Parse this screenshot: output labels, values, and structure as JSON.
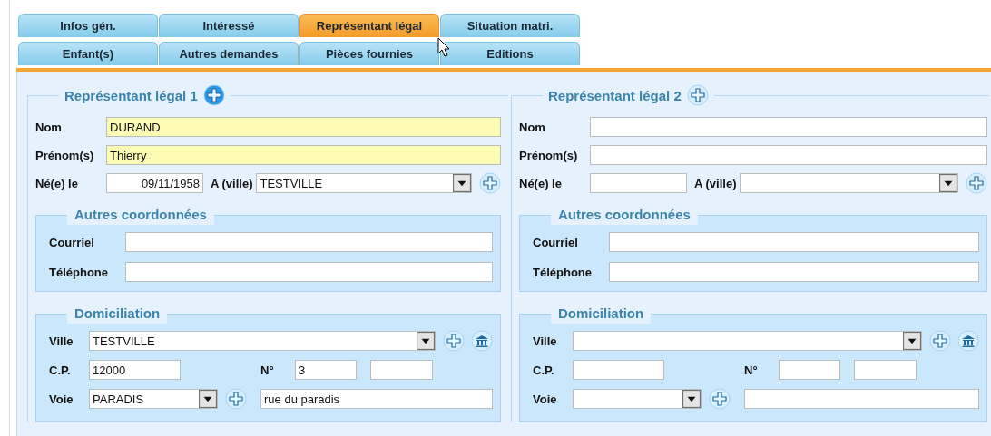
{
  "tabs": [
    {
      "label": "Infos gén.",
      "selected": false
    },
    {
      "label": "Intéressé",
      "selected": false
    },
    {
      "label": "Représentant légal",
      "selected": true
    },
    {
      "label": "Situation matri.",
      "selected": false
    },
    {
      "label": "Enfant(s)",
      "selected": false
    },
    {
      "label": "Autres demandes",
      "selected": false
    },
    {
      "label": "Pièces fournies",
      "selected": false
    },
    {
      "label": "Editions",
      "selected": false
    }
  ],
  "representatives": [
    {
      "title": "Représentant légal 1",
      "add_active": true,
      "identity": [
        {
          "label": "Nom",
          "value": "DURAND",
          "highlighted": true
        },
        {
          "label": "Prénom(s)",
          "value": "Thierry",
          "highlighted": true
        }
      ],
      "birth": {
        "label": "Né(e) le",
        "value": "09/11/1958",
        "city_label": "A (ville)",
        "city_value": "TESTVILLE"
      },
      "contact": {
        "title": "Autres coordonnées",
        "fields": [
          {
            "label": "Courriel"
          },
          {
            "label": "Téléphone"
          }
        ]
      },
      "address": {
        "title": "Domiciliation",
        "city": {
          "label": "Ville",
          "value": "TESTVILLE"
        },
        "postcode": {
          "label": "C.P.",
          "value": "12000"
        },
        "number": {
          "label": "N°",
          "value": "3"
        },
        "street": {
          "label": "Voie",
          "type_value": "PARADIS",
          "name_value": "rue du paradis"
        }
      }
    },
    {
      "title": "Représentant légal 2",
      "add_active": false,
      "identity": [
        {
          "label": "Nom",
          "highlighted": false
        },
        {
          "label": "Prénom(s)",
          "highlighted": false
        }
      ],
      "birth": {
        "label": "Né(e) le",
        "city_label": "A (ville)"
      },
      "contact": {
        "title": "Autres coordonnées",
        "fields": [
          {
            "label": "Courriel"
          },
          {
            "label": "Téléphone"
          }
        ]
      },
      "address": {
        "title": "Domiciliation",
        "city": {
          "label": "Ville"
        },
        "postcode": {
          "label": "C.P."
        },
        "number": {
          "label": "N°"
        },
        "street": {
          "label": "Voie"
        }
      }
    }
  ]
}
